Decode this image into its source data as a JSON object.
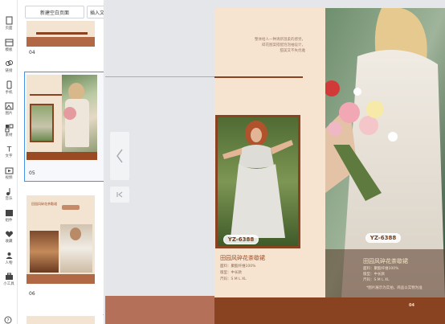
{
  "rail": [
    {
      "label": "页面",
      "icon": "page-icon"
    },
    {
      "label": "模板",
      "icon": "template-icon"
    },
    {
      "label": "链接",
      "icon": "link-icon"
    },
    {
      "label": "手机",
      "icon": "mobile-icon"
    },
    {
      "label": "图片",
      "icon": "image-icon"
    },
    {
      "label": "素材",
      "icon": "material-icon"
    },
    {
      "label": "文字",
      "icon": "text-icon"
    },
    {
      "label": "视频",
      "icon": "video-icon"
    },
    {
      "label": "音乐",
      "icon": "music-icon"
    },
    {
      "label": "组件",
      "icon": "widget-icon"
    },
    {
      "label": "收藏",
      "icon": "heart-icon"
    },
    {
      "label": "人物",
      "icon": "person-icon"
    },
    {
      "label": "小工具",
      "icon": "toolbox-icon"
    }
  ],
  "panel": {
    "add_button": "新建空白页面",
    "insert_select": "插入文档",
    "thumbs": [
      {
        "num": "04"
      },
      {
        "num": "05"
      },
      {
        "num": "06",
        "caption": "田园风碎花茶歇裙"
      }
    ]
  },
  "spread": {
    "intro_lines": [
      "整体给人一种清新温柔的感觉，",
      "碎花图案搭配泡泡袖设计，",
      "甜美又不失优雅"
    ],
    "left_code": "YZ-6388",
    "right_code": "YZ-6388",
    "left_title": "田园风碎花茶歇裙",
    "left_specs": [
      "面料：聚酯纤维100%",
      "版型：中长款",
      "尺码：S M L XL"
    ],
    "right_title": "田园风碎花茶歇裙",
    "right_specs": [
      "面料：聚酯纤维100%",
      "版型：中长款",
      "尺码：S M L XL"
    ],
    "right_note": "*图片展示为实拍，商品以实物为准",
    "page_num": "04"
  },
  "colors": {
    "accent": "#8a4320",
    "page_bg": "#f6e4d1",
    "selection": "#4a90e2"
  }
}
